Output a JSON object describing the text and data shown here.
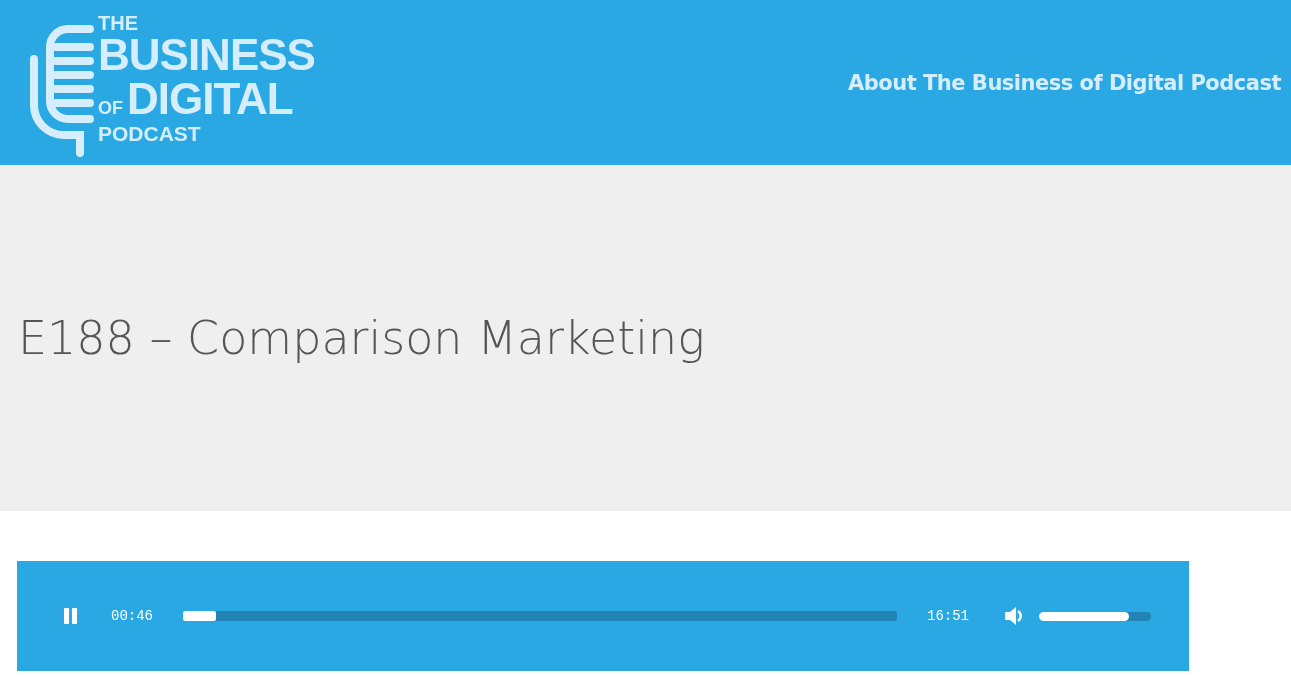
{
  "header": {
    "logo": {
      "line_1": "THE",
      "line_2": "BUSINESS",
      "line_3a": "OF",
      "line_3b": "DIGITAL",
      "line_4": "PODCAST"
    },
    "nav": [
      {
        "label": "About The Business of Digital Podcast"
      }
    ]
  },
  "hero": {
    "title": "E188 – Comparison Marketing"
  },
  "player": {
    "playing": true,
    "current_time": "00:46",
    "progress": {
      "level": 0.046
    },
    "duration": "16:51",
    "muted": false,
    "volume": {
      "level": 0.8
    }
  }
}
